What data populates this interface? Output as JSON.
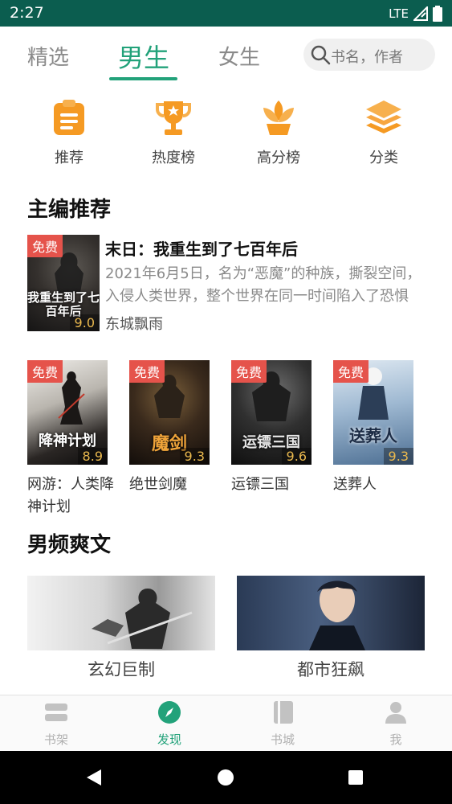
{
  "status": {
    "time": "2:27",
    "network": "LTE"
  },
  "tabs": [
    {
      "label": "精选"
    },
    {
      "label": "男生"
    },
    {
      "label": "女生"
    }
  ],
  "search": {
    "placeholder": "书名，作者"
  },
  "shortcuts": [
    {
      "label": "推荐"
    },
    {
      "label": "热度榜"
    },
    {
      "label": "高分榜"
    },
    {
      "label": "分类"
    }
  ],
  "sections": {
    "editor_pick": "主编推荐",
    "male_hits": "男频爽文"
  },
  "free_label": "免费",
  "featured": {
    "title": "末日：我重生到了七百年后",
    "description": "2021年6月5日，名为“恶魔”的种族，撕裂空间，入侵人类世界，整个世界在同一时间陷入了恐惧",
    "author": "东城飘雨",
    "score": "9.0",
    "cover_text": "我重生到了七百年后"
  },
  "books": [
    {
      "name": "网游：人类降神计划",
      "score": "8.9",
      "cover_text": "降神计划"
    },
    {
      "name": "绝世剑魔",
      "score": "9.3",
      "cover_text": "魔剑"
    },
    {
      "name": "运镖三国",
      "score": "9.6",
      "cover_text": "运镖三国"
    },
    {
      "name": "送葬人",
      "score": "9.3",
      "cover_text": "送葬人"
    }
  ],
  "genres": [
    {
      "label": "玄幻巨制"
    },
    {
      "label": "都市狂飙"
    }
  ],
  "bottom_nav": [
    {
      "label": "书架"
    },
    {
      "label": "发现"
    },
    {
      "label": "书城"
    },
    {
      "label": "我"
    }
  ],
  "colors": {
    "accent": "#22a27a",
    "status_bar": "#0b5d4f",
    "free_tag": "#e5534b",
    "icon_orange": "#f59a23"
  }
}
